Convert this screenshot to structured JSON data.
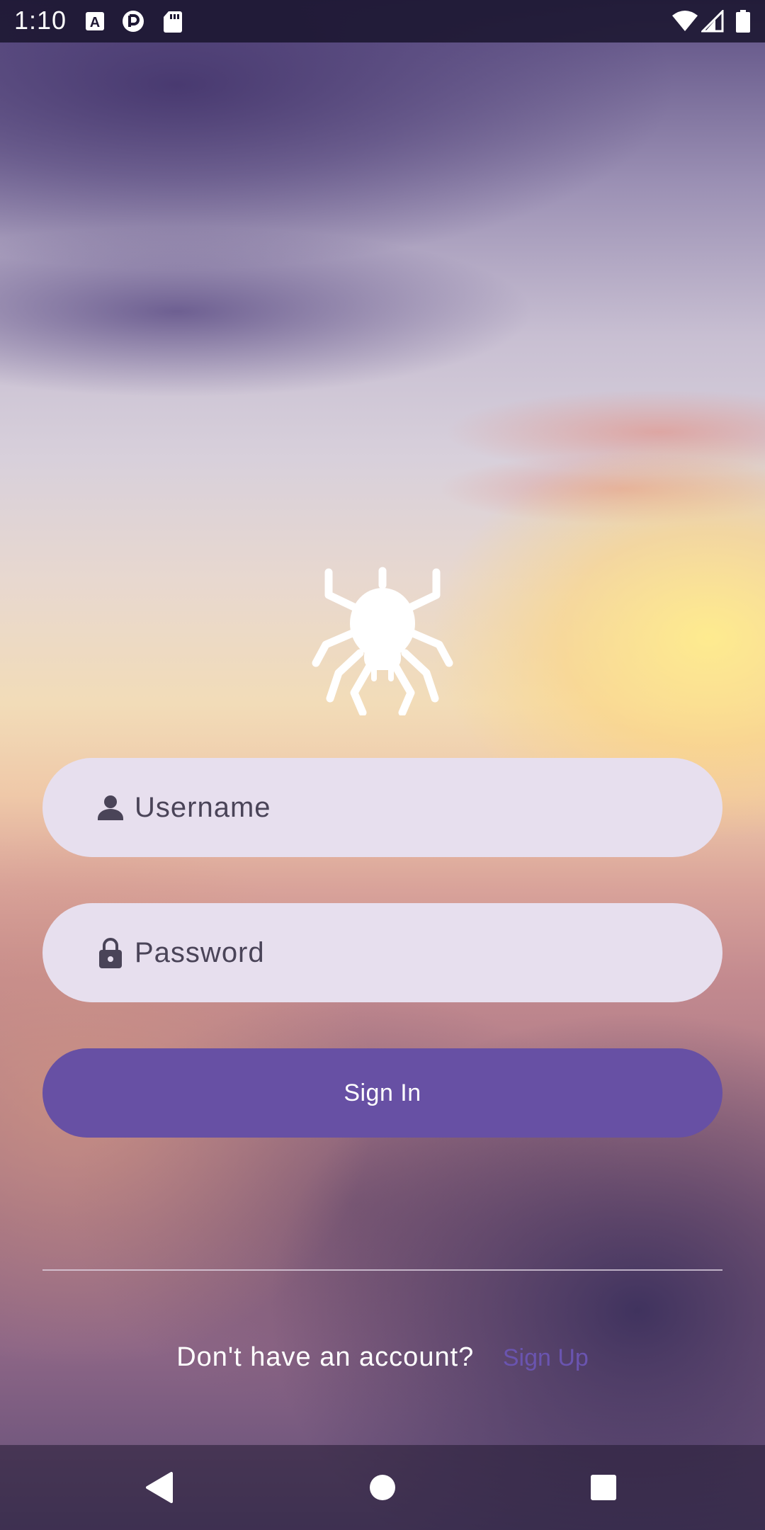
{
  "status_bar": {
    "time": "1:10",
    "left_icons": [
      "text-a-icon",
      "pocket-icon",
      "sd-card-icon"
    ],
    "right_icons": [
      "wifi-icon",
      "cell-signal-icon",
      "battery-icon"
    ]
  },
  "logo": {
    "icon": "spider-icon"
  },
  "login_form": {
    "username": {
      "icon": "person-icon",
      "placeholder": "Username"
    },
    "password": {
      "icon": "lock-icon",
      "placeholder": "Password"
    },
    "sign_in_label": "Sign In"
  },
  "signup": {
    "prompt": "Don't have an account?",
    "link_label": "Sign Up"
  },
  "nav_bar": {
    "buttons": [
      "back-icon",
      "home-icon",
      "recents-icon"
    ]
  },
  "colors": {
    "accent": "#6750a4",
    "field_background": "#e7dfee",
    "field_text": "#4a4458",
    "link": "#6a54b0"
  }
}
